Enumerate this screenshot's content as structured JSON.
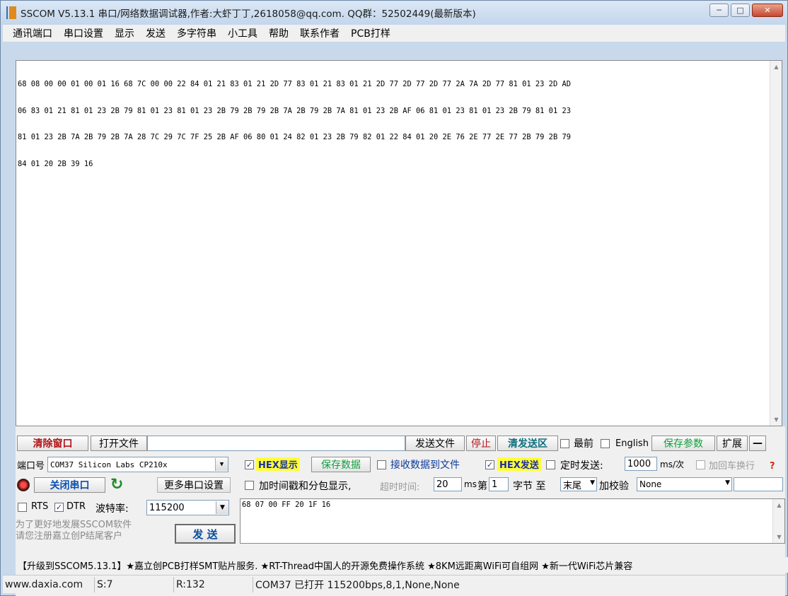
{
  "window": {
    "title": "SSCOM V5.13.1 串口/网络数据调试器,作者:大虾丁丁,2618058@qq.com. QQ群：52502449(最新版本)",
    "controls": {
      "minimize": "─",
      "maximize": "□",
      "close": "✕"
    }
  },
  "menu": {
    "items": [
      "通讯端口",
      "串口设置",
      "显示",
      "发送",
      "多字符串",
      "小工具",
      "帮助",
      "联系作者",
      "PCB打样"
    ]
  },
  "receive": {
    "lines": [
      "68 08 00 00 01 00 01 16 68 7C 00 00 22 84 01 21 83 01 21 2D 77 83 01 21 83 01 21 2D 77 2D 77 2D 77 2A 7A 2D 77 81 01 23 2D AD",
      "06 83 01 21 81 01 23 2B 79 81 01 23 81 01 23 2B 79 2B 79 2B 7A 2B 79 2B 7A 81 01 23 2B AF 06 81 01 23 81 01 23 2B 79 81 01 23",
      "81 01 23 2B 7A 2B 79 2B 7A 28 7C 29 7C 7F 25 2B AF 06 80 01 24 82 01 23 2B 79 82 01 22 84 01 20 2E 76 2E 77 2E 77 2B 79 2B 79",
      "84 01 20 2B 39 16"
    ]
  },
  "toolbar": {
    "clear_window": "清除窗口",
    "open_file": "打开文件",
    "file_path": "",
    "send_file": "发送文件",
    "stop": "停止",
    "clear_send": "清发送区",
    "topmost": "最前",
    "english": "English",
    "save_params": "保存参数",
    "expand": "扩展",
    "collapse": "—"
  },
  "port": {
    "label": "端口号",
    "value": "COM37 Silicon Labs CP210x ",
    "close_port": "关闭串口",
    "more_settings": "更多串口设置",
    "rts": "RTS",
    "dtr": "DTR",
    "baud_label": "波特率:",
    "baud_value": "115200",
    "promo_line1": "为了更好地发展SSCOM软件",
    "promo_line2": "请您注册嘉立创P结尾客户",
    "send_button": "发 送"
  },
  "options": {
    "hex_display": "HEX显示",
    "save_data": "保存数据",
    "recv_to_file": "接收数据到文件",
    "hex_send": "HEX发送",
    "timed_send": "定时发送:",
    "timed_value": "1000",
    "timed_unit": "ms/次",
    "append_crlf": "加回车换行",
    "timestamp": "加时间戳和分包显示,",
    "timeout_label": "超时时间:",
    "timeout_value": "20",
    "timeout_unit": "ms",
    "byte_prefix": "第",
    "byte_start": "1",
    "byte_word": "字节 至",
    "byte_end": "末尾",
    "checksum_label": "加校验",
    "checksum_value": "None"
  },
  "send": {
    "text": "68 07 00 FF 20 1F 16"
  },
  "ad": {
    "text": "【升级到SSCOM5.13.1】★嘉立创PCB打样SMT贴片服务. ★RT-Thread中国人的开源免费操作系统 ★8KM远距离WiFi可自组网 ★新一代WiFi芯片兼容"
  },
  "status": {
    "site": "www.daxia.com",
    "sent": "S:7",
    "received": "R:132",
    "port_state": "COM37 已打开  115200bps,8,1,None,None"
  }
}
